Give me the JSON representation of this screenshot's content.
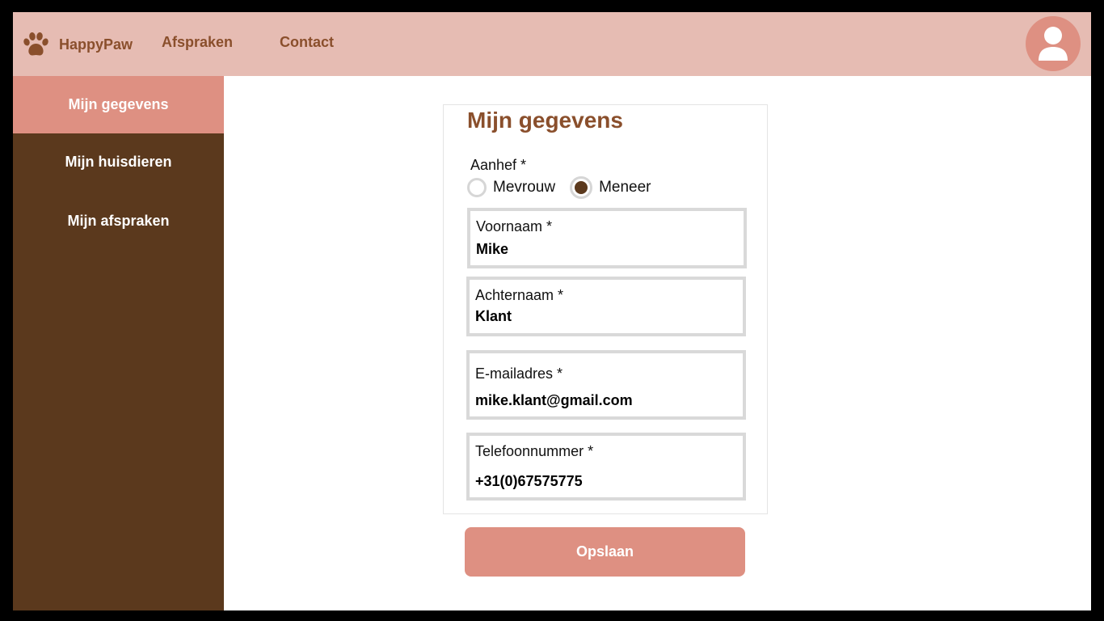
{
  "header": {
    "brand": "HappyPaw",
    "nav": [
      "Afspraken",
      "Contact"
    ],
    "paw_icon": "paw-icon",
    "avatar_icon": "user-icon"
  },
  "sidebar": {
    "items": [
      {
        "label": "Mijn gegevens",
        "active": true
      },
      {
        "label": "Mijn huisdieren",
        "active": false
      },
      {
        "label": "Mijn afspraken",
        "active": false
      }
    ]
  },
  "form": {
    "title": "Mijn gegevens",
    "aanhef": {
      "label": "Aanhef *",
      "options": [
        "Mevrouw",
        "Meneer"
      ],
      "selected": "Meneer"
    },
    "voornaam": {
      "label": "Voornaam *",
      "value": "Mike"
    },
    "achternaam": {
      "label": "Achternaam *",
      "value": "Klant"
    },
    "email": {
      "label": "E-mailadres *",
      "value": "mike.klant@gmail.com"
    },
    "telefoon": {
      "label": "Telefoonnummer *",
      "value": "+31(0)67575775"
    },
    "save_label": "Opslaan"
  },
  "colors": {
    "header_bg": "#e6bcb3",
    "accent": "#de9082",
    "sidebar_bg": "#5b391d",
    "title_brown": "#8a4f2c"
  }
}
